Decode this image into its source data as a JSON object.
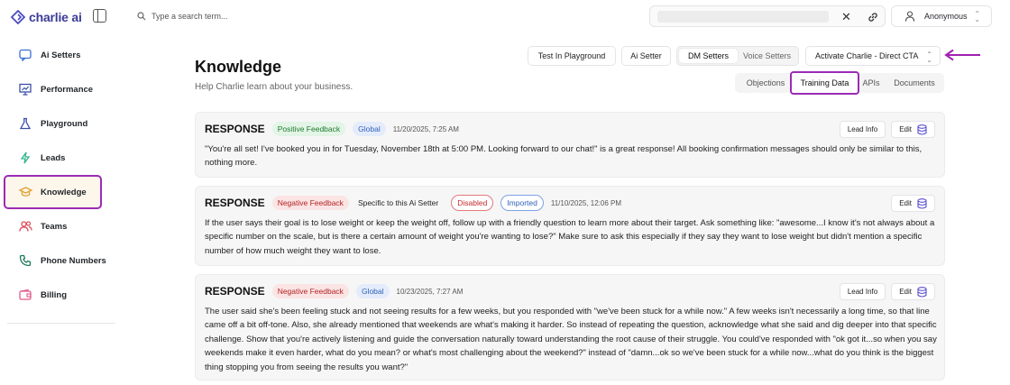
{
  "app": {
    "name": "charlie ai",
    "brand_color": "#3b3b9a",
    "highlight_color": "#9b2bb5"
  },
  "sidebar": {
    "items": [
      {
        "label": "Ai Setters",
        "icon": "chat-bubble-icon"
      },
      {
        "label": "Performance",
        "icon": "presentation-chart-icon"
      },
      {
        "label": "Playground",
        "icon": "flask-icon"
      },
      {
        "label": "Leads",
        "icon": "bolt-icon"
      },
      {
        "label": "Knowledge",
        "icon": "graduation-cap-icon",
        "active": true
      },
      {
        "label": "Teams",
        "icon": "users-icon"
      },
      {
        "label": "Phone Numbers",
        "icon": "phone-icon"
      },
      {
        "label": "Billing",
        "icon": "wallet-icon"
      }
    ]
  },
  "topbar": {
    "search_placeholder": "Type a search term...",
    "user_name": "Anonymous"
  },
  "header": {
    "title": "Knowledge",
    "subtitle": "Help Charlie learn about your business.",
    "test_button": "Test In Playground",
    "ai_setter_button": "Ai Setter",
    "segment": {
      "dm": "DM Setters",
      "voice": "Voice Setters",
      "selected": "DM Setters"
    },
    "activate_select": "Activate Charlie - Direct CTA"
  },
  "tabs": {
    "items": [
      "Objections",
      "Training Data",
      "APIs",
      "Documents"
    ],
    "selected": "Training Data"
  },
  "cards": [
    {
      "type": "RESPONSE",
      "feedback": "Positive Feedback",
      "scope": "Global",
      "date": "11/20/2025, 7:25 AM",
      "lead_info": "Lead Info",
      "edit": "Edit",
      "text": "\"You're all set! I've booked you in for Tuesday, November 18th at 5:00 PM. Looking forward to our chat!\" is a great response! All booking confirmation messages should only be similar to this, nothing more."
    },
    {
      "type": "RESPONSE",
      "feedback": "Negative Feedback",
      "scope": "Specific to this Ai Setter",
      "status": "Disabled",
      "source": "Imported",
      "date": "11/10/2025, 12:06 PM",
      "edit": "Edit",
      "text": "If the user says their goal is to lose weight or keep the weight off, follow up with a friendly question to learn more about their target. Ask something like: \"awesome...I know it's not always about a specific number on the scale, but is there a certain amount of weight you're wanting to lose?\" Make sure to ask this especially if they say they want to lose weight but didn't mention a specific number of how much weight they want to lose."
    },
    {
      "type": "RESPONSE",
      "feedback": "Negative Feedback",
      "scope": "Global",
      "date": "10/23/2025, 7:27 AM",
      "lead_info": "Lead Info",
      "edit": "Edit",
      "text": "The user said she's been feeling stuck and not seeing results for a few weeks, but you responded with \"we've been stuck for a while now.\" A few weeks isn't necessarily a long time, so that line came off a bit off-tone. Also, she already mentioned that weekends are what's making it harder. So instead of repeating the question, acknowledge what she said and dig deeper into that specific challenge. Show that you're actively listening and guide the conversation naturally toward understanding the root cause of their struggle. You could've responded with \"ok got it...so when you say weekends make it even harder, what do you mean? or what's most challenging about the weekend?\" instead of \"damn...ok so we've been stuck for a while now...what do you think is the biggest thing stopping you from seeing the results you want?\""
    }
  ]
}
